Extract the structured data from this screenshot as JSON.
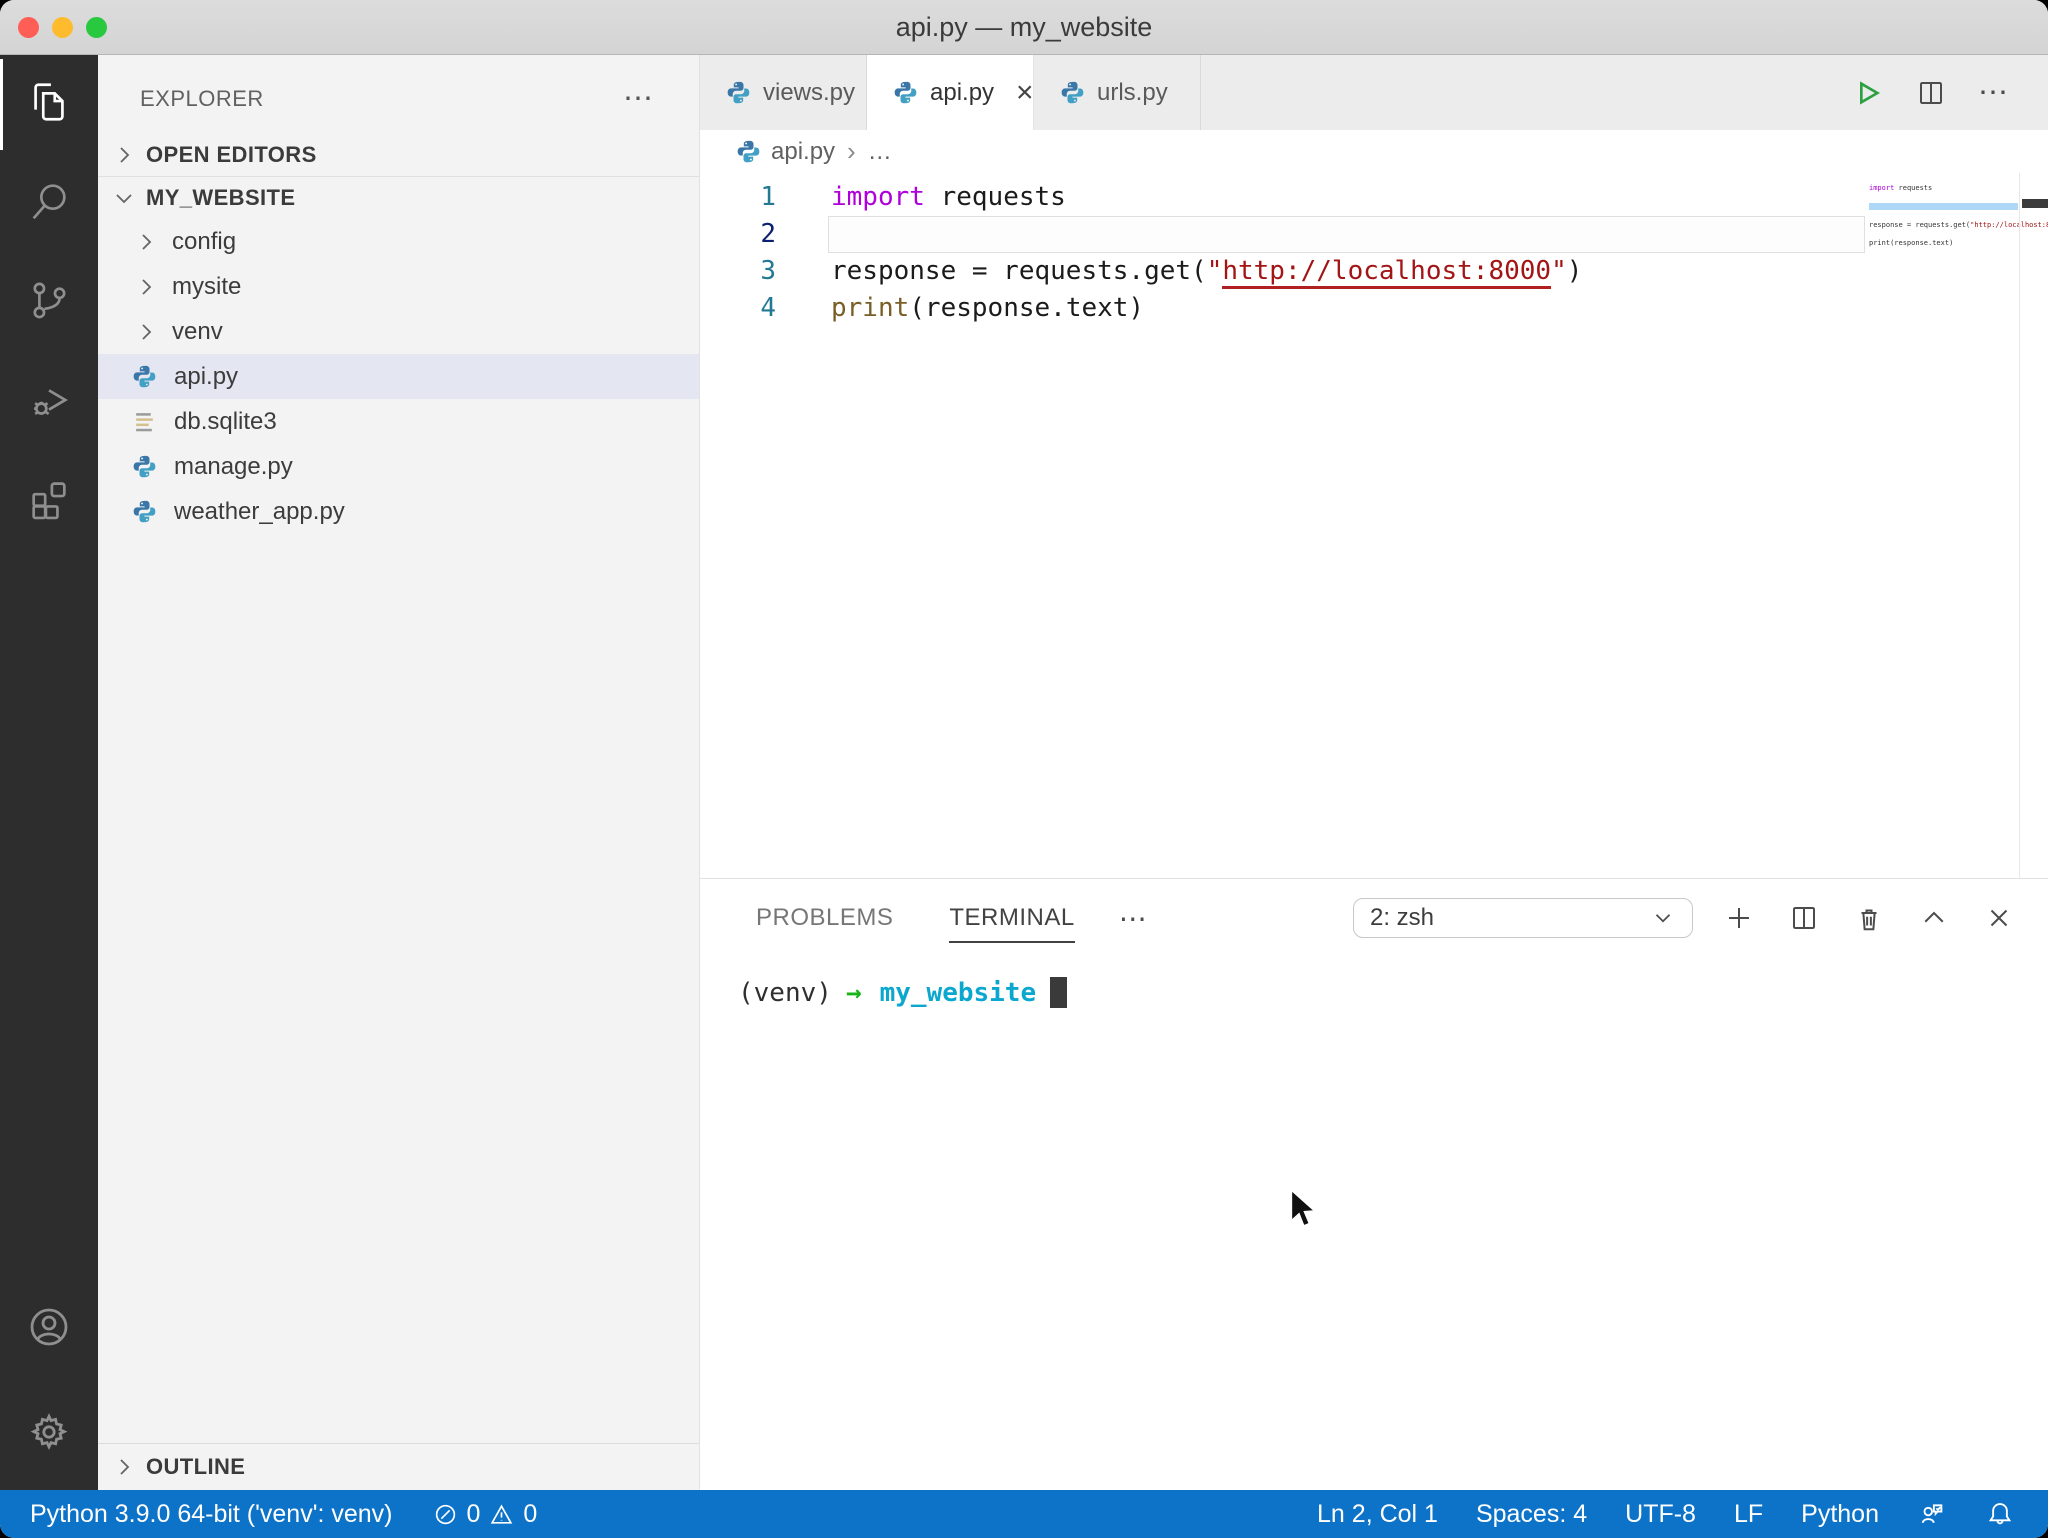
{
  "window": {
    "title": "api.py — my_website"
  },
  "activity_bar": {
    "items": [
      {
        "name": "explorer",
        "icon": "files-icon",
        "active": true
      },
      {
        "name": "search",
        "icon": "search-icon",
        "active": false
      },
      {
        "name": "source-control",
        "icon": "source-control-icon",
        "active": false
      },
      {
        "name": "run-and-debug",
        "icon": "run-debug-icon",
        "active": false
      },
      {
        "name": "extensions",
        "icon": "extensions-icon",
        "active": false
      }
    ],
    "bottom_items": [
      {
        "name": "accounts",
        "icon": "account-icon"
      },
      {
        "name": "settings",
        "icon": "gear-icon"
      }
    ]
  },
  "sidebar": {
    "title": "EXPLORER",
    "more": "⋯",
    "open_editors": "OPEN EDITORS",
    "root": "MY_WEBSITE",
    "outline": "OUTLINE",
    "files": [
      {
        "name": "config",
        "type": "folder"
      },
      {
        "name": "mysite",
        "type": "folder"
      },
      {
        "name": "venv",
        "type": "folder"
      },
      {
        "name": "api.py",
        "type": "python",
        "selected": true
      },
      {
        "name": "db.sqlite3",
        "type": "database"
      },
      {
        "name": "manage.py",
        "type": "python"
      },
      {
        "name": "weather_app.py",
        "type": "python"
      }
    ]
  },
  "editor": {
    "tabs": [
      {
        "label": "views.py",
        "active": false
      },
      {
        "label": "api.py",
        "active": true,
        "close": "×"
      },
      {
        "label": "urls.py",
        "active": false
      }
    ],
    "breadcrumb": {
      "file": "api.py",
      "sep": "›",
      "more": "…"
    },
    "lines": [
      {
        "num": "1",
        "kw": "import",
        "rest": " requests"
      },
      {
        "num": "2",
        "current": true
      },
      {
        "num": "3",
        "pre": "response = requests.get(",
        "q1": "\"",
        "url": "http://localhost:8000",
        "q2": "\"",
        "post": ")"
      },
      {
        "num": "4",
        "fn": "print",
        "rest": "(response.text)"
      }
    ]
  },
  "panel": {
    "tabs": [
      {
        "label": "PROBLEMS",
        "active": false
      },
      {
        "label": "TERMINAL",
        "active": true
      }
    ],
    "more": "⋯",
    "shell_select": "2: zsh",
    "actions": [
      "new-terminal-icon",
      "split-terminal-icon",
      "kill-terminal-icon",
      "maximize-panel-icon",
      "close-panel-icon"
    ],
    "terminal": {
      "venv": "(venv)",
      "arrow": "→",
      "cwd": "my_website"
    }
  },
  "status_bar": {
    "python_version": "Python 3.9.0 64-bit ('venv': venv)",
    "errors": "0",
    "warnings": "0",
    "right": {
      "cursor_position": "Ln 2, Col 1",
      "indentation": "Spaces: 4",
      "encoding": "UTF-8",
      "eol": "LF",
      "language": "Python"
    }
  },
  "colors": {
    "statusbar_blue": "#0d73c9",
    "activitybar_dark": "#2d2d2d",
    "sidebar_bg": "#f3f3f3",
    "selection_row": "#e4e6f1",
    "keyword": "#af00db",
    "function": "#795e26",
    "string_error": "#a31515",
    "terminal_cwd_cyan": "#0ba7cf",
    "terminal_arrow_green": "#17b41a",
    "python_icon_blue": "#3a77a8",
    "python_icon_teal": "#42a0c4",
    "run_green": "#2da042"
  }
}
